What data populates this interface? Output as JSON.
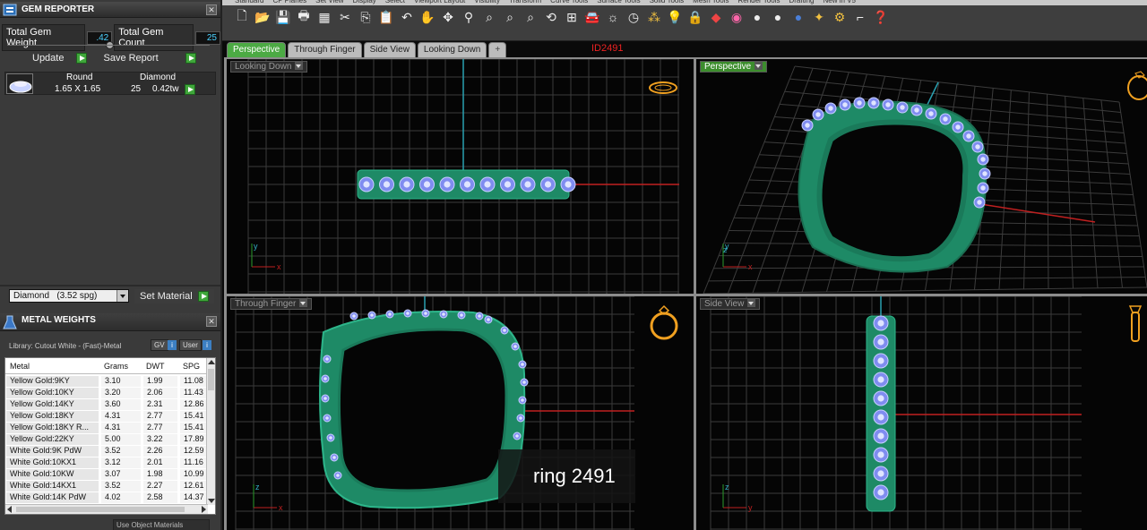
{
  "gem_panel": {
    "title": "GEM REPORTER",
    "total_weight_label": "Total Gem Weight",
    "total_weight_value": ".42",
    "total_count_label": "Total Gem Count",
    "total_count_value": "25",
    "update_label": "Update",
    "save_report_label": "Save Report",
    "columns": [
      "Round",
      "Diamond"
    ],
    "gem_row": {
      "size": "1.65 X 1.65",
      "count": "25",
      "weight": "0.42tw"
    },
    "material": "Diamond   (3.52 spg)",
    "set_material_label": "Set Material"
  },
  "metal_panel": {
    "title": "METAL WEIGHTS",
    "library": "Library: Cutout White - (Fast)-Metal",
    "gv_label": "GV",
    "user_label": "User",
    "info_glyph": "i",
    "columns": [
      "Metal",
      "Grams",
      "DWT",
      "SPG"
    ],
    "rows": [
      {
        "metal": "Yellow Gold:9KY",
        "grams": "3.10",
        "dwt": "1.99",
        "spg": "11.08"
      },
      {
        "metal": "Yellow Gold:10KY",
        "grams": "3.20",
        "dwt": "2.06",
        "spg": "11.43"
      },
      {
        "metal": "Yellow Gold:14KY",
        "grams": "3.60",
        "dwt": "2.31",
        "spg": "12.86"
      },
      {
        "metal": "Yellow Gold:18KY",
        "grams": "4.31",
        "dwt": "2.77",
        "spg": "15.41"
      },
      {
        "metal": "Yellow Gold:18KY R...",
        "grams": "4.31",
        "dwt": "2.77",
        "spg": "15.41"
      },
      {
        "metal": "Yellow Gold:22KY",
        "grams": "5.00",
        "dwt": "3.22",
        "spg": "17.89"
      },
      {
        "metal": "White Gold:9K PdW",
        "grams": "3.52",
        "dwt": "2.26",
        "spg": "12.59"
      },
      {
        "metal": "White Gold:10KX1",
        "grams": "3.12",
        "dwt": "2.01",
        "spg": "11.16"
      },
      {
        "metal": "White Gold:10KW",
        "grams": "3.07",
        "dwt": "1.98",
        "spg": "10.99"
      },
      {
        "metal": "White Gold:14KX1",
        "grams": "3.52",
        "dwt": "2.27",
        "spg": "12.61"
      },
      {
        "metal": "White Gold:14K PdW",
        "grams": "4.02",
        "dwt": "2.58",
        "spg": "14.37"
      }
    ],
    "use_object_materials": "Use Object Materials"
  },
  "menu_tabs": [
    "Standard",
    "CP Planes",
    "Set View",
    "Display",
    "Select",
    "Viewport Layout",
    "Visibility",
    "Transform",
    "Curve Tools",
    "Surface Tools",
    "Solid Tools",
    "Mesh Tools",
    "Render Tools",
    "Drafting",
    "New in V5"
  ],
  "viewport_tabs": [
    "Perspective",
    "Through Finger",
    "Side View",
    "Looking Down"
  ],
  "add_tab_glyph": "+",
  "id_label": "ID2491",
  "viewports": {
    "top_left": "Looking Down",
    "top_right": "Perspective",
    "bottom_left": "Through Finger",
    "bottom_right": "Side View"
  },
  "axes": {
    "x": "x",
    "y": "y",
    "z": "z"
  },
  "watermark": "ring 2491",
  "colors": {
    "ring_green": "#1e8a66",
    "gem_blue": "#7f8cf0",
    "x_axis": "#c02020",
    "y_axis": "#2aa0b0",
    "active_tab": "#4caa44"
  }
}
